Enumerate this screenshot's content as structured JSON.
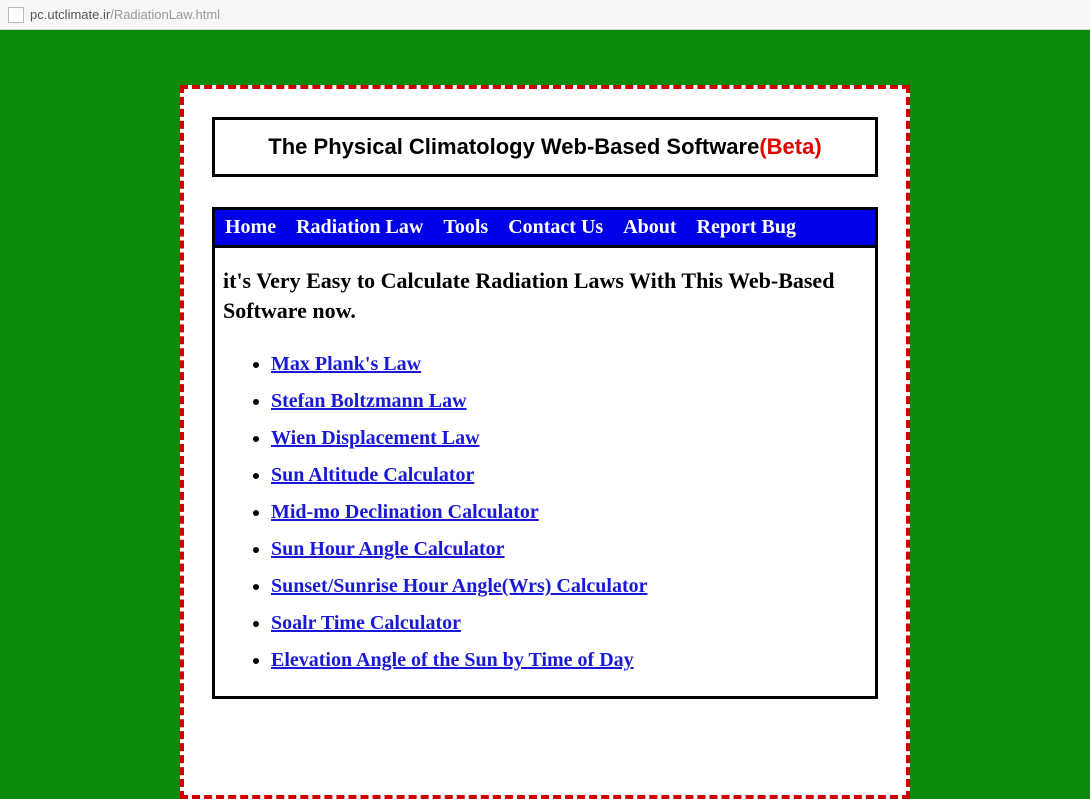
{
  "address": {
    "host": "pc.utclimate.ir",
    "path": "/RadiationLaw.html"
  },
  "header": {
    "title_text": "The Physical Climatology Web-Based Software",
    "beta_text": "(Beta)"
  },
  "nav": {
    "items": [
      "Home",
      "Radiation Law",
      "Tools",
      "Contact Us",
      "About",
      "Report Bug"
    ]
  },
  "intro": "it's Very Easy to Calculate Radiation Laws With This Web-Based Software now.",
  "links": [
    "Max Plank's Law",
    "Stefan Boltzmann Law",
    "Wien Displacement Law",
    "Sun Altitude Calculator",
    "Mid-mo Declination Calculator",
    "Sun Hour Angle Calculator",
    "Sunset/Sunrise Hour Angle(Wrs) Calculator",
    "Soalr Time Calculator",
    "Elevation Angle of the Sun by Time of Day"
  ]
}
